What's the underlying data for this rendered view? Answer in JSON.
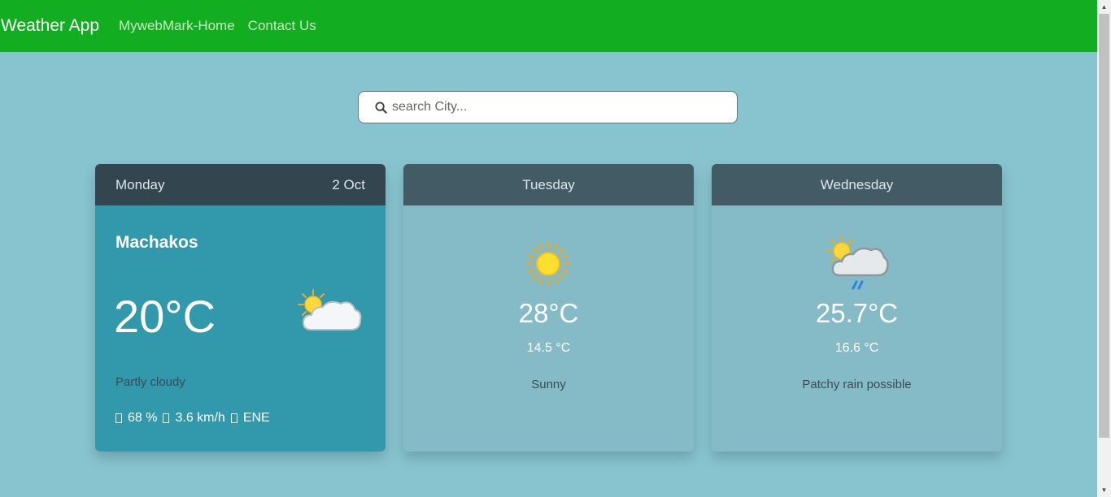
{
  "navbar": {
    "brand": "Weather App",
    "links": [
      "MywebMark-Home",
      "Contact Us"
    ],
    "color": "#13ad22"
  },
  "search": {
    "placeholder": "search City...",
    "icon": "search-icon"
  },
  "today": {
    "day": "Monday",
    "date": "2 Oct",
    "city": "Machakos",
    "temp": "20°C",
    "condition": "Partly cloudy",
    "icon": "partly-cloudy-icon",
    "humidity": "68 %",
    "wind_speed": "3.6 km/h",
    "wind_dir": "ENE"
  },
  "forecast": [
    {
      "day": "Tuesday",
      "max": "28°C",
      "min": "14.5 °C",
      "condition": "Sunny",
      "icon": "sun-icon"
    },
    {
      "day": "Wednesday",
      "max": "25.7°C",
      "min": "16.6 °C",
      "condition": "Patchy rain possible",
      "icon": "patchy-rain-icon"
    }
  ]
}
